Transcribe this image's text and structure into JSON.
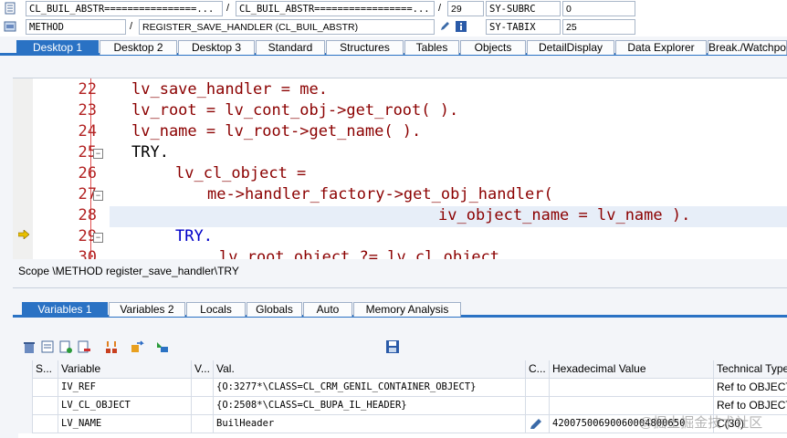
{
  "info": {
    "row1": {
      "field1": "CL_BUIL_ABSTR================...",
      "sep1": "/",
      "field2": "CL_BUIL_ABSTR=================...",
      "sep2": "/",
      "line": "29",
      "sysvar": "SY-SUBRC",
      "sysval": "0"
    },
    "row2": {
      "field1": "METHOD",
      "sep1": "/",
      "field2": "REGISTER_SAVE_HANDLER (CL_BUIL_ABSTR)",
      "sysvar": "SY-TABIX",
      "sysval": "25"
    }
  },
  "tabs": [
    "Desktop 1",
    "Desktop 2",
    "Desktop 3",
    "Standard",
    "Structures",
    "Tables",
    "Objects",
    "DetailDisplay",
    "Data Explorer",
    "Break./Watchpoints"
  ],
  "editor": {
    "lines": [
      {
        "num": "22",
        "code": "lv_save_handler = me."
      },
      {
        "num": "23",
        "code": "lv_root = lv_cont_obj->get_root( )."
      },
      {
        "num": "24",
        "code": "lv_name = lv_root->get_name( )."
      },
      {
        "num": "25",
        "code": "TRY."
      },
      {
        "num": "26",
        "code": "lv_cl_object ="
      },
      {
        "num": "27",
        "code": "me->handler_factory->get_obj_handler("
      },
      {
        "num": "28",
        "code": "iv_object_name = lv_name )."
      },
      {
        "num": "29",
        "code": "TRY."
      },
      {
        "num": "30",
        "code": "lv_root_object ?= lv_cl_object"
      }
    ]
  },
  "scope": "Scope \\METHOD register_save_handler\\TRY",
  "var_tabs": [
    "Variables 1",
    "Variables 2",
    "Locals",
    "Globals",
    "Auto",
    "Memory Analysis"
  ],
  "table": {
    "headers": [
      "S...",
      "Variable",
      "V...",
      "Val.",
      "C...",
      "Hexadecimal Value",
      "Technical Type"
    ],
    "rows": [
      {
        "variable": "IV_REF",
        "value": "{O:3277*\\CLASS=CL_CRM_GENIL_CONTAINER_OBJECT}",
        "hex": "",
        "type": "Ref to OBJECT"
      },
      {
        "variable": "LV_CL_OBJECT",
        "value": "{O:2508*\\CLASS=CL_BUPA_IL_HEADER}",
        "hex": "",
        "type": "Ref to OBJECT"
      },
      {
        "variable": "LV_NAME",
        "value": "BuilHeader",
        "hex": "42007500690060004800650",
        "type": "C(30)"
      }
    ]
  },
  "watermark": "@掘土掘金技术社区"
}
